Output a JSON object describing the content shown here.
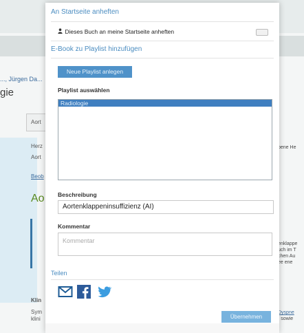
{
  "modal": {
    "pin_section_title": "An Startseite anheften",
    "pin_label": "Dieses Buch an meine Startseite anheften",
    "playlist_section_title": "E-Book zu Playlist hinzufügen",
    "new_button_label": "Neue Playlist anlegen",
    "playlist_select_label": "Playlist auswählen",
    "playlist_items": [
      "Radiologie"
    ],
    "description_label": "Beschreibung",
    "description_value": "Aortenklappeninsuffizienz (AI)",
    "comment_label": "Kommentar",
    "comment_placeholder": "Kommentar",
    "share_label": "Teilen",
    "apply_button_label": "Übernehmen"
  },
  "background": {
    "breadcrumb": "..., Jürgen Da...",
    "heading": "gie",
    "tab_label": "Aort",
    "line1": "Herz",
    "line2": "Aort",
    "link": "Beob",
    "green_title": "Ao",
    "bold_line": "Klin",
    "line_sym": "Sym",
    "line_klin": "klini",
    "right_top": "bene He",
    "right_lines": [
      "enklappe",
      "uch im T",
      "chen Au",
      "ee ene"
    ],
    "right_bottom": "Dyspne",
    "right_bottom2": ") sowie"
  }
}
